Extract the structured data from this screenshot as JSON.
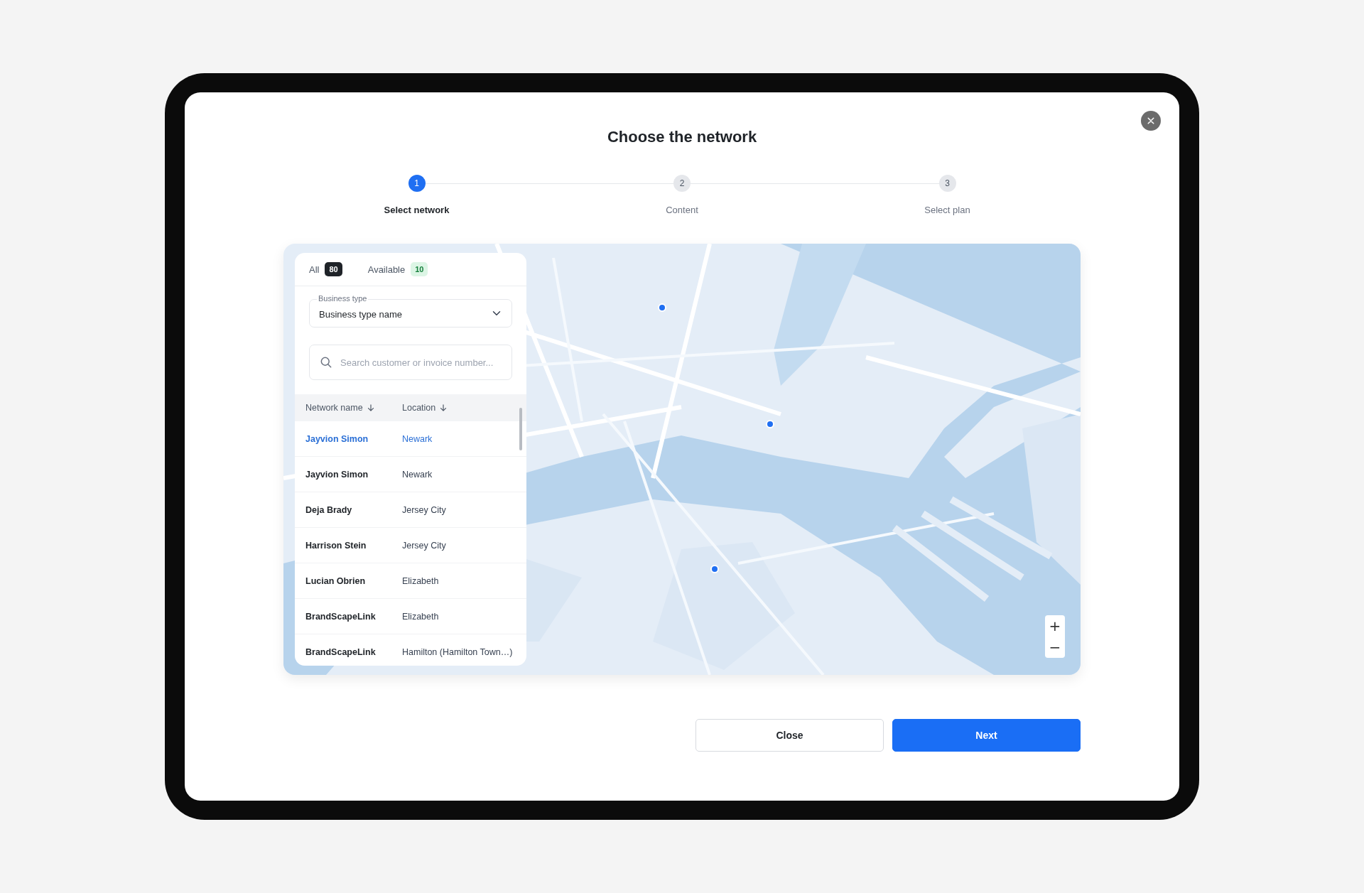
{
  "dialog": {
    "title": "Choose the network",
    "steps": [
      {
        "number": "1",
        "label": "Select network",
        "selected": true
      },
      {
        "number": "2",
        "label": "Content",
        "selected": false
      },
      {
        "number": "3",
        "label": "Select plan",
        "selected": false
      }
    ],
    "filter_tabs": [
      {
        "label": "All",
        "count": "80",
        "kind": "dark"
      },
      {
        "label": "Available",
        "count": "10",
        "kind": "green"
      }
    ],
    "business_type": {
      "label": "Business type",
      "value": "Business type name"
    },
    "search": {
      "placeholder": "Search customer or invoice number..."
    },
    "table": {
      "columns": [
        "Network name",
        "Location"
      ],
      "rows": [
        {
          "cells": [
            "Jayvion Simon",
            "Newark"
          ],
          "selected": true
        },
        {
          "cells": [
            "Jayvion Simon",
            "Newark"
          ],
          "selected": false
        },
        {
          "cells": [
            "Deja Brady",
            "Jersey City"
          ],
          "selected": false
        },
        {
          "cells": [
            "Harrison Stein",
            "Jersey City"
          ],
          "selected": false
        },
        {
          "cells": [
            "Lucian Obrien",
            "Elizabeth"
          ],
          "selected": false
        },
        {
          "cells": [
            "BrandScapeLink",
            "Elizabeth"
          ],
          "selected": false
        },
        {
          "cells": [
            "BrandScapeLink",
            "Hamilton (Hamilton Town…)"
          ],
          "selected": false
        }
      ]
    },
    "map": {
      "kind": "picture",
      "zoom_controls": [
        "+",
        "−"
      ]
    },
    "buttons": [
      {
        "label": "Close",
        "kind": "secondary"
      },
      {
        "label": "Next",
        "kind": "primary"
      }
    ]
  }
}
